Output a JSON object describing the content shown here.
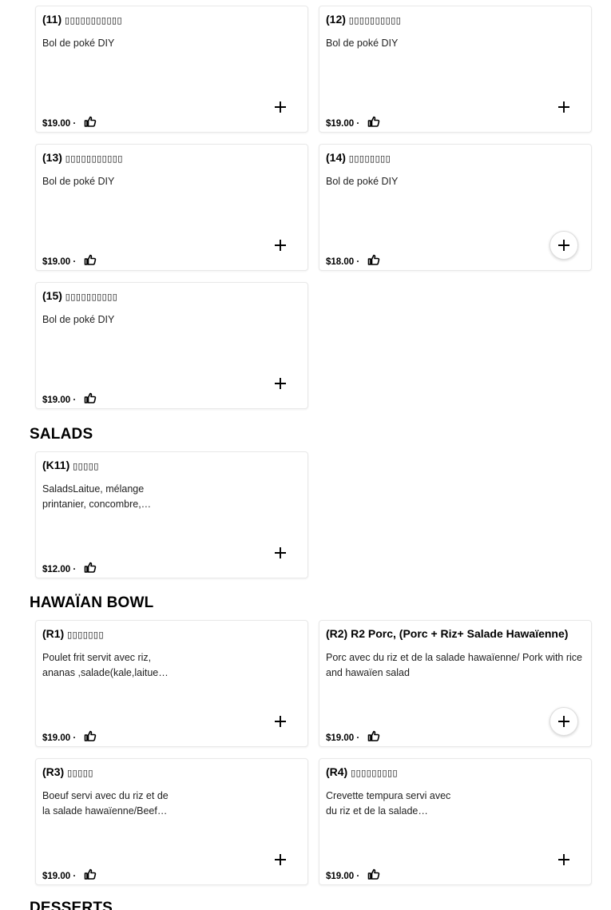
{
  "sections": {
    "salads": "SALADS",
    "hawaian": "HAWAÏAN BOWL",
    "desserts": "DESSERTS"
  },
  "items": [
    {
      "code": "(11)",
      "glyphs": "▯▯▯▯▯▯▯▯▯▯▯",
      "desc": "Bol de poké DIY",
      "price": "$19.00 ·"
    },
    {
      "code": "(12)",
      "glyphs": "▯▯▯▯▯▯▯▯▯▯",
      "desc": "Bol de poké DIY",
      "price": "$19.00 ·"
    },
    {
      "code": "(13)",
      "glyphs": "▯▯▯▯▯▯▯▯▯▯▯",
      "desc": "Bol de poké DIY",
      "price": "$19.00 ·"
    },
    {
      "code": "(14)",
      "glyphs": "▯▯▯▯▯▯▯▯",
      "desc": "Bol de poké DIY",
      "price": "$18.00 ·"
    },
    {
      "code": "(15)",
      "glyphs": "▯▯▯▯▯▯▯▯▯▯",
      "desc": "Bol de poké DIY",
      "price": "$19.00 ·"
    },
    {
      "code": "(K11)",
      "glyphs": "▯▯▯▯▯",
      "desc": "SaladsLaitue, mélange printanier, concombre,…",
      "price": "$12.00 ·"
    },
    {
      "code": "(R1)",
      "glyphs": "▯▯▯▯▯▯▯",
      "desc": "Poulet frit servit avec riz, ananas ,salade(kale,laitue…",
      "price": "$19.00 ·"
    },
    {
      "code": "(R2) R2 Porc, (Porc + Riz+ Salade Hawaïenne)",
      "glyphs": "",
      "desc": "Porc avec du riz et de la salade hawaïenne/ Pork with rice and hawaïen salad",
      "price": "$19.00 ·"
    },
    {
      "code": "(R3)",
      "glyphs": "▯▯▯▯▯",
      "desc": "Boeuf servi avec du riz et de la salade hawaïenne/Beef…",
      "price": "$19.00 ·"
    },
    {
      "code": "(R4)",
      "glyphs": "▯▯▯▯▯▯▯▯▯",
      "desc": "Crevette tempura servi avec du riz et de la salade…",
      "price": "$19.00 ·"
    }
  ],
  "icons": {
    "like": "thumbs-up-icon",
    "add": "plus-icon"
  }
}
